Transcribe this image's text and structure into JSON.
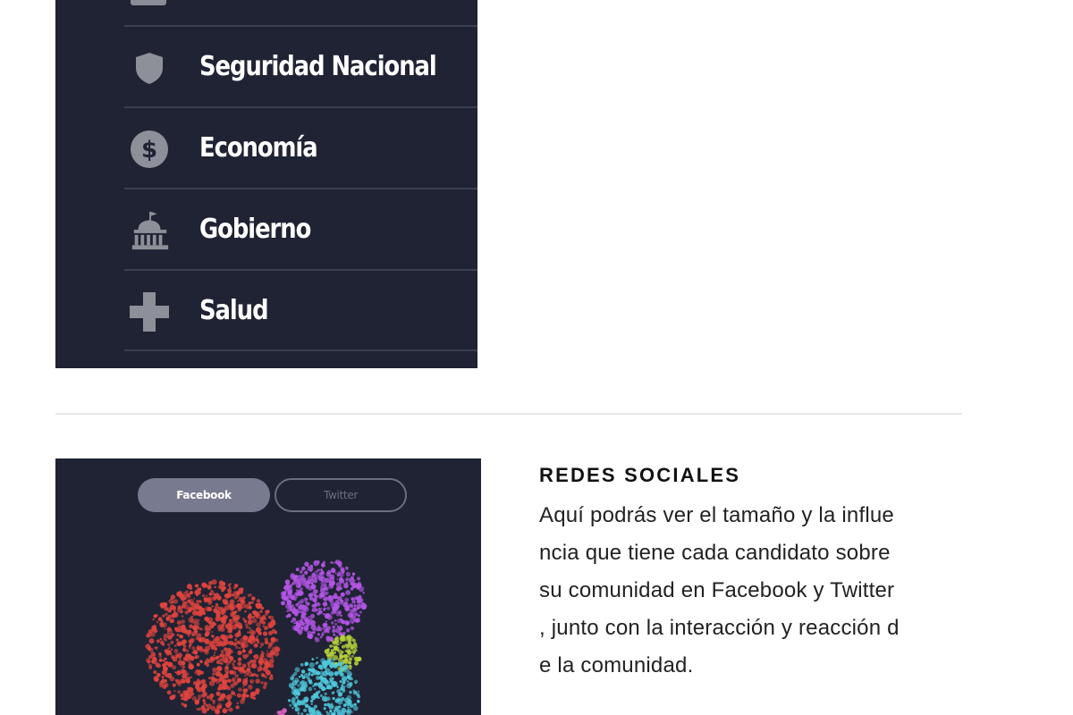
{
  "menu": {
    "items": [
      {
        "label": "Seguridad Nacional",
        "icon": "shield-icon"
      },
      {
        "label": "Economía",
        "icon": "dollar-coin-icon"
      },
      {
        "label": "Gobierno",
        "icon": "government-building-icon"
      },
      {
        "label": "Salud",
        "icon": "health-cross-icon"
      }
    ],
    "icon_color": "#8e9099",
    "background": "#1f2333"
  },
  "social_preview": {
    "tabs": [
      {
        "label": "Facebook",
        "active": true
      },
      {
        "label": "Twitter",
        "active": false
      }
    ],
    "clusters": [
      {
        "color": "#e0443e"
      },
      {
        "color": "#b355e6"
      },
      {
        "color": "#b6d23a"
      },
      {
        "color": "#4fc8dd"
      },
      {
        "color": "#e05fc8"
      }
    ]
  },
  "social_section": {
    "title": "REDES SOCIALES",
    "description_lines": [
      "Aquí podrás ver el tamaño y la influe",
      "ncia que tiene cada candidato sobre",
      "su comunidad en Facebook y Twitter",
      ", junto con la interacción y reacción d",
      "e la comunidad."
    ]
  }
}
